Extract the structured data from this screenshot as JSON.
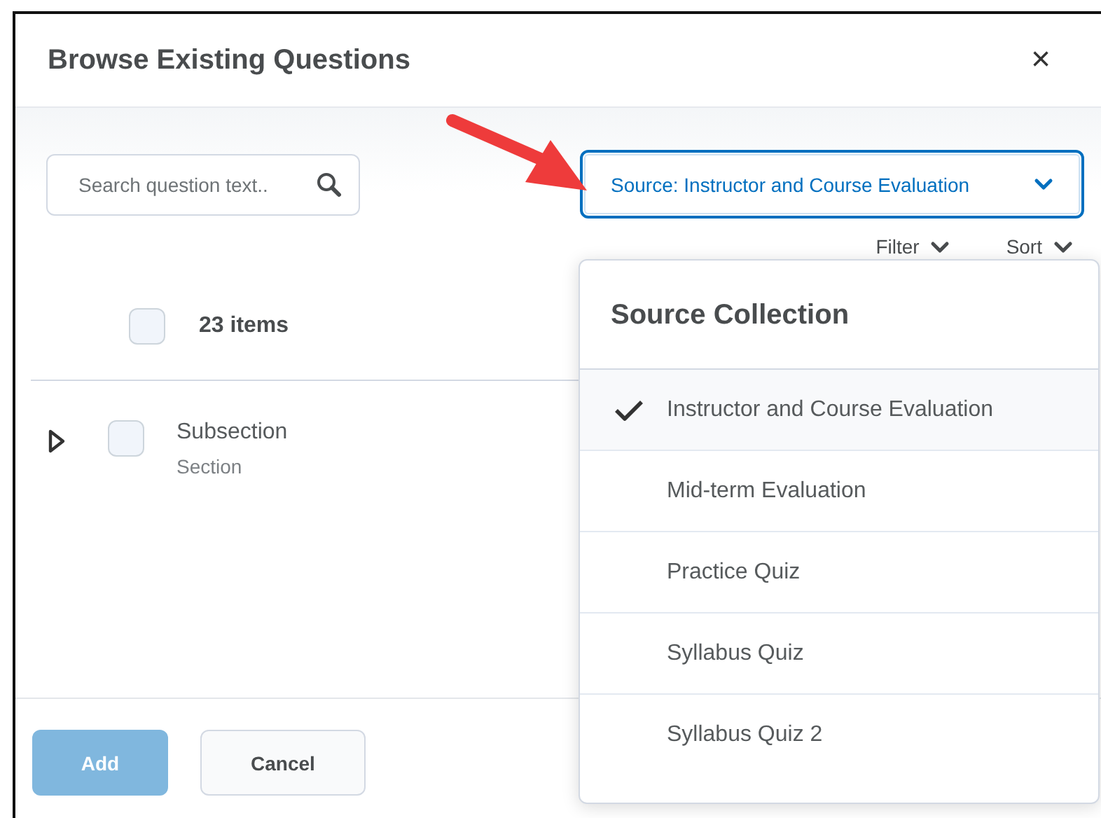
{
  "dialog": {
    "title": "Browse Existing Questions",
    "close": "×"
  },
  "search": {
    "placeholder": "Search question text.."
  },
  "source_button": {
    "label": "Source: Instructor and Course Evaluation",
    "expanded": true
  },
  "toolbar": [
    "Filter",
    "Sort"
  ],
  "list": {
    "select_all_checked": false,
    "count": "23 items",
    "rows": [
      {
        "title": "Subsection",
        "subtitle": "Section",
        "checked": false,
        "expanded": false
      }
    ]
  },
  "menu": {
    "title": "Source Collection",
    "items": [
      {
        "label": "Instructor and Course Evaluation",
        "selected": true
      },
      {
        "label": "Mid-term Evaluation",
        "selected": false
      },
      {
        "label": "Practice Quiz",
        "selected": false
      },
      {
        "label": "Syllabus Quiz",
        "selected": false
      },
      {
        "label": "Syllabus Quiz 2",
        "selected": false
      }
    ]
  },
  "buttons": [
    {
      "label": "Add",
      "kind": "primary",
      "disabled": true
    },
    {
      "label": "Cancel",
      "kind": "secondary",
      "disabled": false
    }
  ]
}
